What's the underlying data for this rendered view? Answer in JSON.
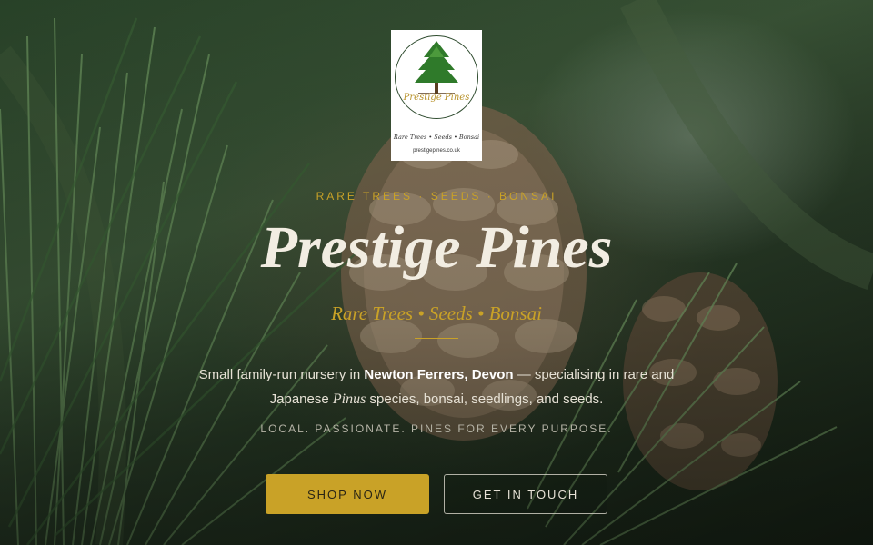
{
  "logo": {
    "brand": "Prestige Pines",
    "tagline": "Rare Trees • Seeds • Bonsai",
    "website": "prestigepines.co.uk",
    "icon": "pine-tree-icon"
  },
  "hero": {
    "eyebrow": "RARE TREES · SEEDS · BONSAI",
    "title": "Prestige Pines",
    "subtitle": "Rare Trees • Seeds • Bonsai",
    "description": {
      "part1": "Small family-run nursery in ",
      "location": "Newton Ferrers, Devon",
      "part2": " — specialising in rare and Japanese ",
      "genus": "Pinus",
      "part3": " species, bonsai, seedlings, and seeds."
    },
    "motto": "LOCAL. PASSIONATE. PINES FOR EVERY PURPOSE."
  },
  "actions": {
    "shop": "SHOP NOW",
    "contact": "GET IN TOUCH"
  },
  "colors": {
    "accent_gold": "#c9a227",
    "forest_green": "#2d4a2d",
    "cream_text": "#f2ede2"
  }
}
